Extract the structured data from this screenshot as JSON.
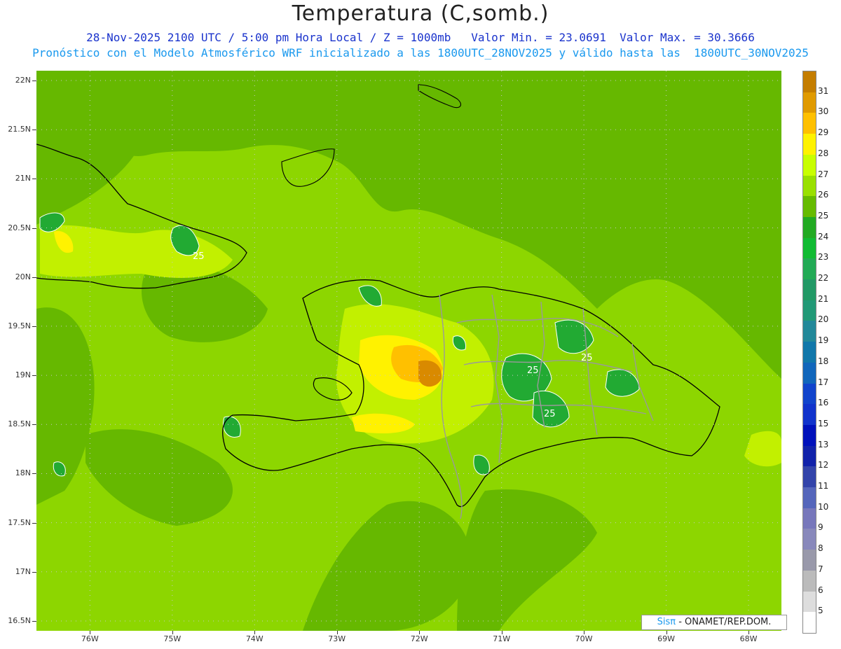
{
  "title": "Temperatura (C,somb.)",
  "subtitle_line1": "28-Nov-2025 2100 UTC / 5:00 pm Hora Local / Z = 1000mb   Valor Min. = 23.0691  Valor Max. = 30.3666",
  "subtitle_line2": "Pronóstico con el Modelo Atmosférico WRF inicializado a las 1800UTC_28NOV2025 y válido hasta las  1800UTC_30NOV2025",
  "credit": {
    "sis": "Sisπ",
    "rest": " - ONAMET/REP.DOM."
  },
  "lat_labels": [
    "22N",
    "21.5N",
    "21N",
    "20.5N",
    "20N",
    "19.5N",
    "19N",
    "18.5N",
    "18N",
    "17.5N",
    "17N",
    "16.5N"
  ],
  "lat_values": [
    22,
    21.5,
    21,
    20.5,
    20,
    19.5,
    19,
    18.5,
    18,
    17.5,
    17,
    16.5
  ],
  "lon_labels": [
    "76W",
    "75W",
    "74W",
    "73W",
    "72W",
    "71W",
    "70W",
    "69W",
    "68W"
  ],
  "lon_values": [
    -76,
    -75,
    -74,
    -73,
    -72,
    -71,
    -70,
    -69,
    -68
  ],
  "contour_labels": [
    "25",
    "25",
    "25",
    "25"
  ],
  "colorbar": {
    "labels": [
      "31",
      "30",
      "29",
      "28",
      "27",
      "26",
      "25",
      "24",
      "23",
      "22",
      "21",
      "20",
      "19",
      "18",
      "17",
      "16",
      "15",
      "13",
      "12",
      "11",
      "10",
      "9",
      "8",
      "7",
      "6",
      "5"
    ],
    "colors": [
      "#c47d00",
      "#e09a00",
      "#ffc000",
      "#fff200",
      "#c8ff00",
      "#99e000",
      "#66bb00",
      "#22aa22",
      "#11bb33",
      "#22aa55",
      "#229966",
      "#229977",
      "#228899",
      "#1177aa",
      "#1166bb",
      "#1144cc",
      "#1133cc",
      "#0011bb",
      "#1122aa",
      "#3344aa",
      "#5566bb",
      "#7777bb",
      "#8888bb",
      "#9999aa",
      "#bbbbbb",
      "#dddddd",
      "#ffffff"
    ]
  },
  "map_colors": {
    "base": "#8dd600",
    "cool": "#66b800",
    "warm": "#c2f000",
    "hot": "#fff200",
    "hotter": "#ffc000",
    "hottest": "#d98a00",
    "cold": "#22aa33"
  }
}
